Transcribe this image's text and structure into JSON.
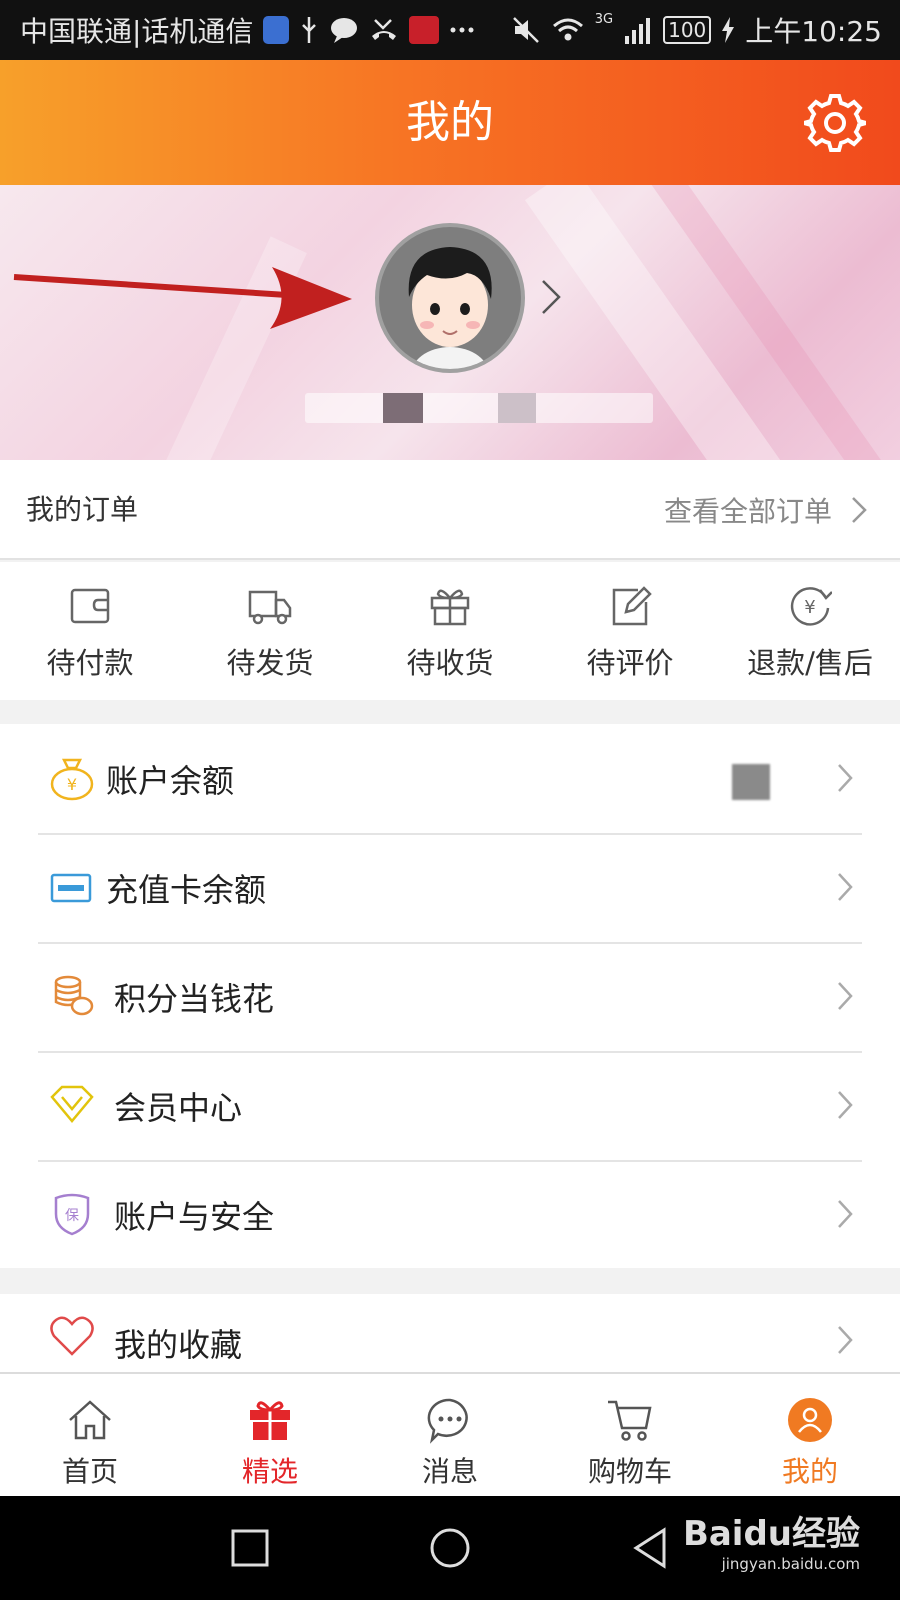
{
  "status_bar": {
    "carrier": "中国联通|话机通信",
    "network": "3G",
    "battery": "100",
    "time": "上午10:25"
  },
  "header": {
    "title": "我的"
  },
  "profile": {},
  "orders": {
    "title": "我的订单",
    "view_all": "查看全部订单",
    "items": [
      {
        "label": "待付款",
        "icon": "wallet-icon"
      },
      {
        "label": "待发货",
        "icon": "truck-icon"
      },
      {
        "label": "待收货",
        "icon": "gift-box-icon"
      },
      {
        "label": "待评价",
        "icon": "edit-icon"
      },
      {
        "label": "退款/售后",
        "icon": "refund-yen-icon"
      }
    ]
  },
  "menu": {
    "items": [
      {
        "label": "账户余额",
        "icon": "money-bag-icon"
      },
      {
        "label": "充值卡余额",
        "icon": "card-icon"
      },
      {
        "label": "积分当钱花",
        "icon": "coins-icon"
      },
      {
        "label": "会员中心",
        "icon": "diamond-icon"
      },
      {
        "label": "账户与安全",
        "icon": "shield-icon",
        "icon_text": "保"
      },
      {
        "label": "我的收藏",
        "icon": "heart-icon"
      }
    ],
    "balance_icon_text": "¥"
  },
  "tabbar": {
    "items": [
      {
        "label": "首页",
        "icon": "home-icon"
      },
      {
        "label": "精选",
        "icon": "gift-icon"
      },
      {
        "label": "消息",
        "icon": "chat-icon"
      },
      {
        "label": "购物车",
        "icon": "cart-icon"
      },
      {
        "label": "我的",
        "icon": "user-icon"
      }
    ]
  },
  "watermark": {
    "brand": "Baidu经验",
    "url": "jingyan.baidu.com"
  },
  "colors": {
    "accent": "#f07a22",
    "header_start": "#f7a02a",
    "header_end": "#f14a1c",
    "red": "#e3262a"
  }
}
